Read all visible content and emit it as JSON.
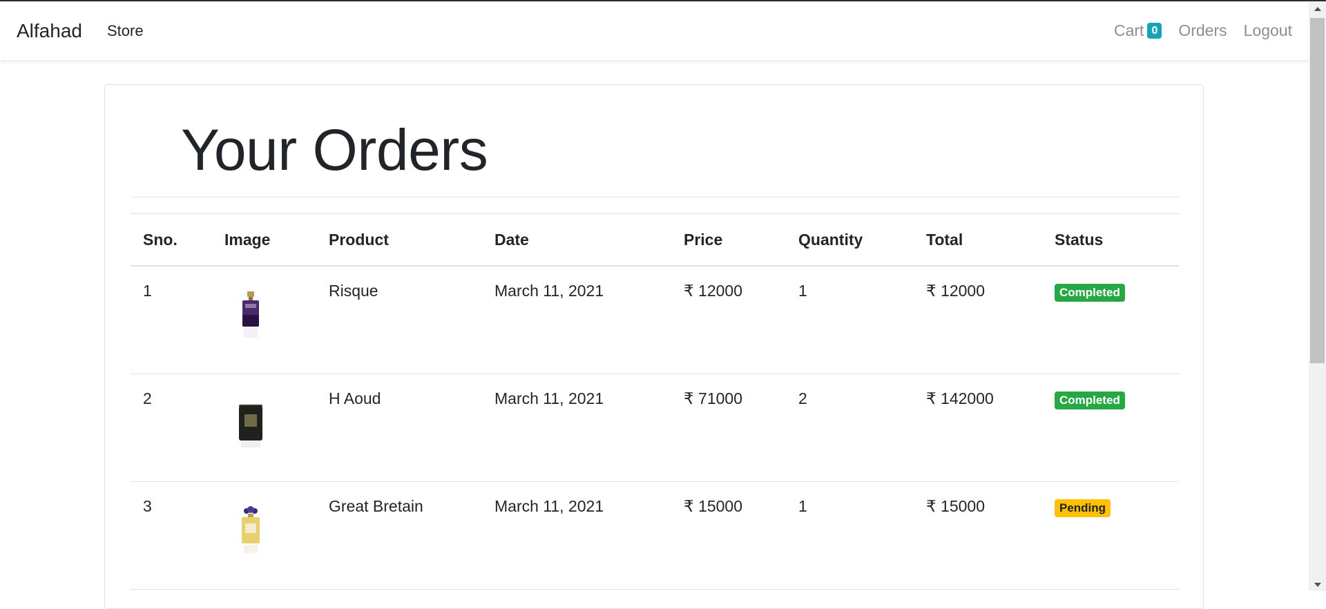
{
  "navbar": {
    "brand": "Alfahad",
    "store": "Store",
    "cart_label": "Cart",
    "cart_count": "0",
    "orders": "Orders",
    "logout": "Logout"
  },
  "page": {
    "title": "Your Orders"
  },
  "table": {
    "headers": [
      "Sno.",
      "Image",
      "Product",
      "Date",
      "Price",
      "Quantity",
      "Total",
      "Status"
    ],
    "rows": [
      {
        "sno": "1",
        "image": "perfume-bottle-purple",
        "product": "Risque",
        "date": "March 11, 2021",
        "price": "₹ 12000",
        "quantity": "1",
        "total": "₹ 12000",
        "status": "Completed"
      },
      {
        "sno": "2",
        "image": "candle-jar-black",
        "product": "H Aoud",
        "date": "March 11, 2021",
        "price": "₹ 71000",
        "quantity": "2",
        "total": "₹ 142000",
        "status": "Completed"
      },
      {
        "sno": "3",
        "image": "perfume-bottle-gold",
        "product": "Great Bretain",
        "date": "March 11, 2021",
        "price": "₹ 15000",
        "quantity": "1",
        "total": "₹ 15000",
        "status": "Pending"
      }
    ]
  },
  "colors": {
    "badge_info": "#17a2b8",
    "badge_success": "#28a745",
    "badge_warning": "#ffc107"
  }
}
